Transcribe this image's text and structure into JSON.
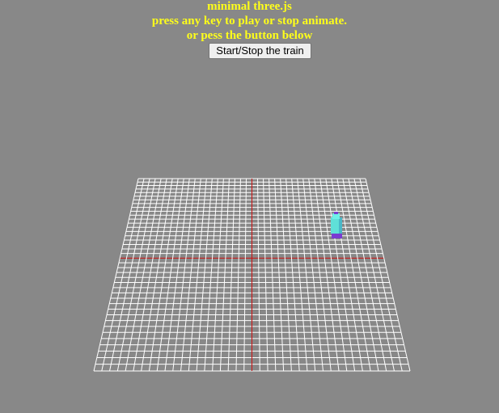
{
  "header": {
    "title": "minimal three.js",
    "line2": "press any key to play or stop animate.",
    "line3": "or pess the button below"
  },
  "controls": {
    "start_stop_label": "Start/Stop the train"
  },
  "colors": {
    "background": "#888888",
    "text": "#ffff1a",
    "grid": "#ffffff",
    "axis": "#cc1111",
    "train_body": "#5fe0d8",
    "train_base": "#7a3bd1"
  }
}
